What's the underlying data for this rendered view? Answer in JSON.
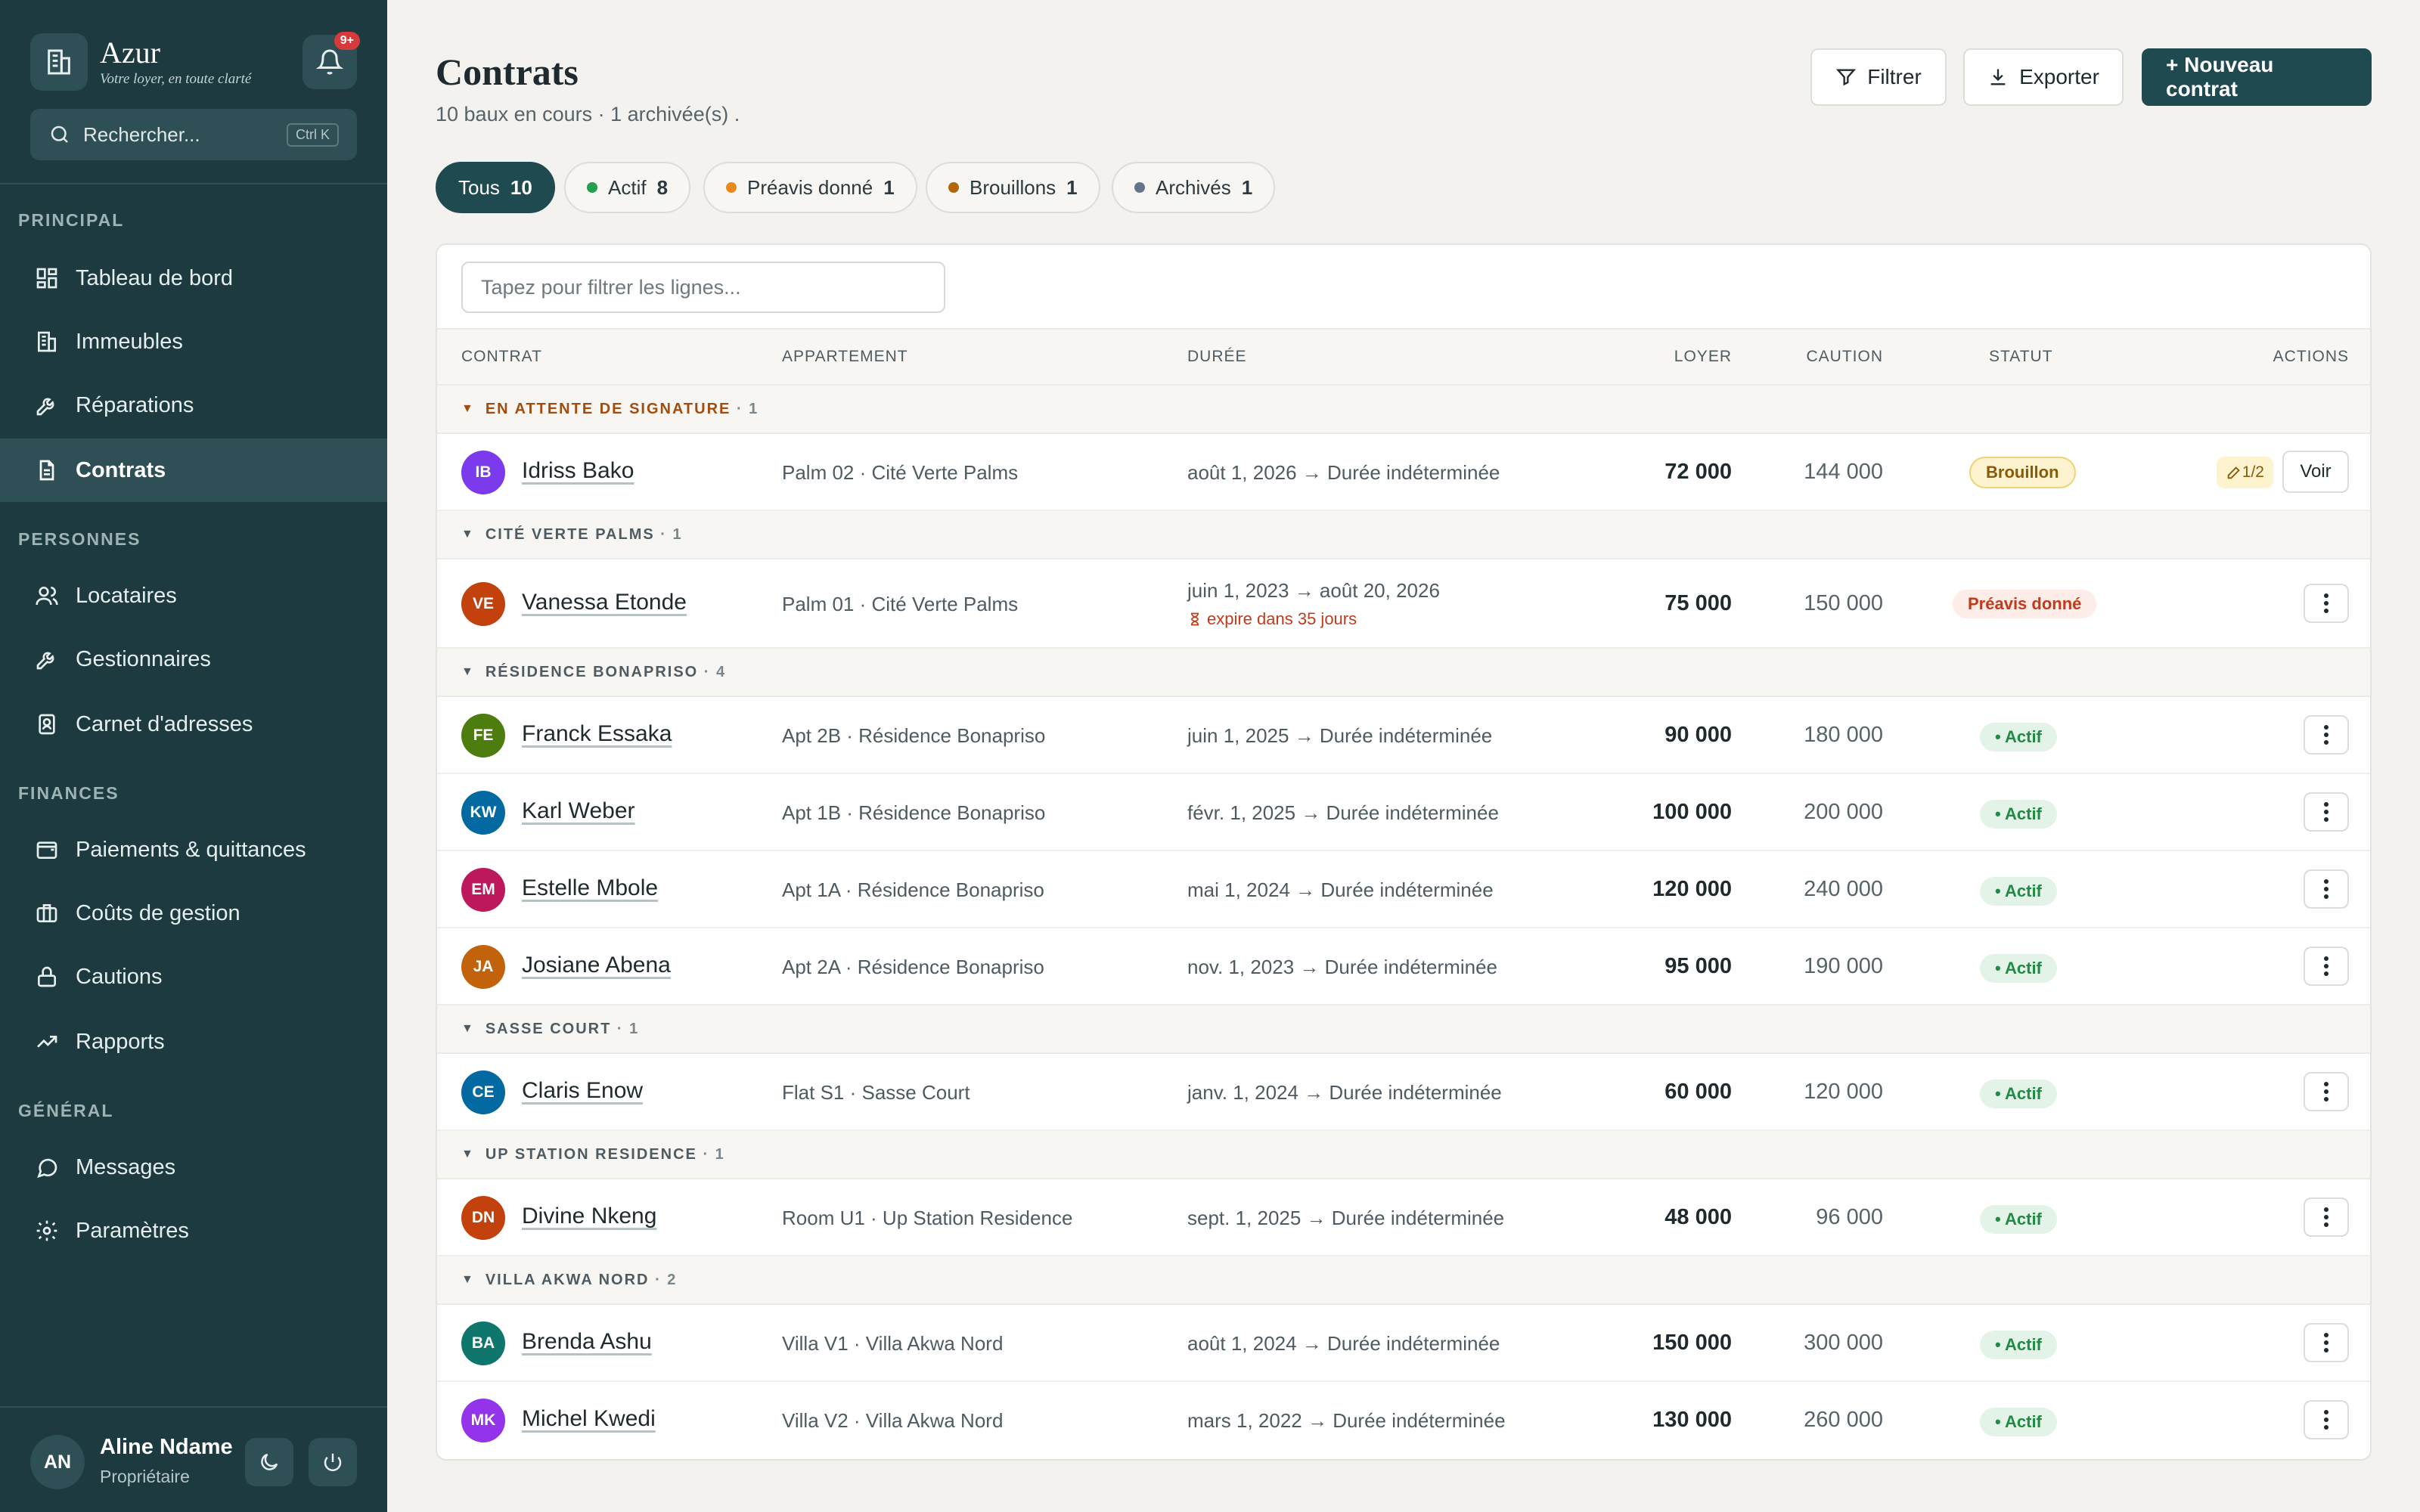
{
  "brand": {
    "name": "Azur",
    "tagline": "Votre loyer, en toute clarté"
  },
  "notifications": {
    "badge": "9+"
  },
  "search": {
    "placeholder": "Rechercher...",
    "shortcut": "Ctrl K"
  },
  "sidebar": {
    "sections": [
      {
        "title": "PRINCIPAL",
        "items": [
          {
            "label": "Tableau de bord",
            "icon": "dashboard-icon"
          },
          {
            "label": "Immeubles",
            "icon": "building-icon"
          },
          {
            "label": "Réparations",
            "icon": "wrench-icon"
          },
          {
            "label": "Contrats",
            "icon": "document-icon",
            "active": true
          }
        ]
      },
      {
        "title": "PERSONNES",
        "items": [
          {
            "label": "Locataires",
            "icon": "users-icon"
          },
          {
            "label": "Gestionnaires",
            "icon": "key-icon"
          },
          {
            "label": "Carnet d'adresses",
            "icon": "contact-book-icon"
          }
        ]
      },
      {
        "title": "FINANCES",
        "items": [
          {
            "label": "Paiements & quittances",
            "icon": "wallet-icon"
          },
          {
            "label": "Coûts de gestion",
            "icon": "briefcase-icon"
          },
          {
            "label": "Cautions",
            "icon": "lock-icon"
          },
          {
            "label": "Rapports",
            "icon": "trend-icon"
          }
        ]
      },
      {
        "title": "GÉNÉRAL",
        "items": [
          {
            "label": "Messages",
            "icon": "chat-icon"
          },
          {
            "label": "Paramètres",
            "icon": "gear-icon"
          }
        ]
      }
    ]
  },
  "user": {
    "initials": "AN",
    "name": "Aline Ndame",
    "role": "Propriétaire"
  },
  "header": {
    "title": "Contrats",
    "subtitle": "10 baux en cours · 1 archivée(s) .",
    "filter_label": "Filtrer",
    "export_label": "Exporter",
    "new_label": "+ Nouveau contrat"
  },
  "chips": [
    {
      "label": "Tous",
      "count": "10",
      "active": true
    },
    {
      "label": "Actif",
      "count": "8",
      "color": "#21a04d"
    },
    {
      "label": "Préavis donné",
      "count": "1",
      "color": "#e8891e"
    },
    {
      "label": "Brouillons",
      "count": "1",
      "color": "#b5650c"
    },
    {
      "label": "Archivés",
      "count": "1",
      "color": "#64748b"
    }
  ],
  "table": {
    "filter_placeholder": "Tapez pour filtrer les lignes...",
    "columns": {
      "contract": "CONTRAT",
      "apartment": "APPARTEMENT",
      "duration": "DURÉE",
      "rent": "LOYER",
      "deposit": "CAUTION",
      "status": "STATUT",
      "actions": "ACTIONS"
    },
    "groups": [
      {
        "title": "EN ATTENTE DE SIGNATURE",
        "count": "· 1",
        "pending": true,
        "rows": [
          {
            "initials": "IB",
            "color": "#7c3aed",
            "name": "Idriss Bako",
            "apartment": "Palm 02 · Cité Verte Palms",
            "duration": "août 1, 2026 → Durée indéterminée",
            "rent": "72 000",
            "deposit": "144 000",
            "status": "Brouillon",
            "status_type": "brouillon",
            "sign": "1/2",
            "action": "Voir"
          }
        ]
      },
      {
        "title": "CITÉ VERTE PALMS",
        "count": "· 1",
        "rows": [
          {
            "initials": "VE",
            "color": "#c2410c",
            "name": "Vanessa Etonde",
            "apartment": "Palm 01 · Cité Verte Palms",
            "duration": "juin 1, 2023 → août 20, 2026",
            "warning": "expire dans 35 jours",
            "rent": "75 000",
            "deposit": "150 000",
            "status": "Préavis donné",
            "status_type": "preavis"
          }
        ]
      },
      {
        "title": "RÉSIDENCE BONAPRISO",
        "count": "· 4",
        "rows": [
          {
            "initials": "FE",
            "color": "#4d7c0f",
            "name": "Franck Essaka",
            "apartment": "Apt 2B · Résidence Bonapriso",
            "duration": "juin 1, 2025 → Durée indéterminée",
            "rent": "90 000",
            "deposit": "180 000",
            "status": "• Actif",
            "status_type": "actif"
          },
          {
            "initials": "KW",
            "color": "#0369a1",
            "name": "Karl Weber",
            "apartment": "Apt 1B · Résidence Bonapriso",
            "duration": "févr. 1, 2025 → Durée indéterminée",
            "rent": "100 000",
            "deposit": "200 000",
            "status": "• Actif",
            "status_type": "actif"
          },
          {
            "initials": "EM",
            "color": "#be185d",
            "name": "Estelle Mbole",
            "apartment": "Apt 1A · Résidence Bonapriso",
            "duration": "mai 1, 2024 → Durée indéterminée",
            "rent": "120 000",
            "deposit": "240 000",
            "status": "• Actif",
            "status_type": "actif"
          },
          {
            "initials": "JA",
            "color": "#c2630c",
            "name": "Josiane Abena",
            "apartment": "Apt 2A · Résidence Bonapriso",
            "duration": "nov. 1, 2023 → Durée indéterminée",
            "rent": "95 000",
            "deposit": "190 000",
            "status": "• Actif",
            "status_type": "actif"
          }
        ]
      },
      {
        "title": "SASSE COURT",
        "count": "· 1",
        "rows": [
          {
            "initials": "CE",
            "color": "#0369a1",
            "name": "Claris Enow",
            "apartment": "Flat S1 · Sasse Court",
            "duration": "janv. 1, 2024 → Durée indéterminée",
            "rent": "60 000",
            "deposit": "120 000",
            "status": "• Actif",
            "status_type": "actif"
          }
        ]
      },
      {
        "title": "UP STATION RESIDENCE",
        "count": "· 1",
        "rows": [
          {
            "initials": "DN",
            "color": "#c2410c",
            "name": "Divine Nkeng",
            "apartment": "Room U1 · Up Station Residence",
            "duration": "sept. 1, 2025 → Durée indéterminée",
            "rent": "48 000",
            "deposit": "96 000",
            "status": "• Actif",
            "status_type": "actif"
          }
        ]
      },
      {
        "title": "VILLA AKWA NORD",
        "count": "· 2",
        "rows": [
          {
            "initials": "BA",
            "color": "#0f766e",
            "name": "Brenda Ashu",
            "apartment": "Villa V1 · Villa Akwa Nord",
            "duration": "août 1, 2024 → Durée indéterminée",
            "rent": "150 000",
            "deposit": "300 000",
            "status": "• Actif",
            "status_type": "actif"
          },
          {
            "initials": "MK",
            "color": "#9333ea",
            "name": "Michel Kwedi",
            "apartment": "Villa V2 · Villa Akwa Nord",
            "duration": "mars 1, 2022 → Durée indéterminée",
            "rent": "130 000",
            "deposit": "260 000",
            "status": "• Actif",
            "status_type": "actif"
          }
        ]
      }
    ]
  }
}
